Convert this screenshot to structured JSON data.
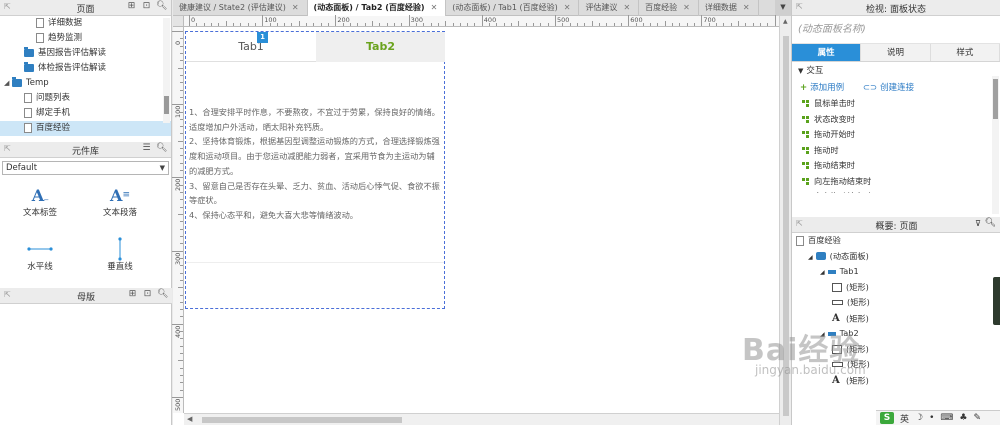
{
  "left_panel": {
    "pages_title": "页面",
    "tree": [
      {
        "label": "详细数据",
        "type": "page",
        "indent": 2
      },
      {
        "label": "趋势监测",
        "type": "page",
        "indent": 2
      },
      {
        "label": "基因报告评估解读",
        "type": "folder",
        "indent": 1
      },
      {
        "label": "体检报告评估解读",
        "type": "folder",
        "indent": 1
      },
      {
        "label": "Temp",
        "type": "folder-open",
        "indent": 0
      },
      {
        "label": "问题列表",
        "type": "page",
        "indent": 1
      },
      {
        "label": "绑定手机",
        "type": "page",
        "indent": 1
      },
      {
        "label": "百度经验",
        "type": "page",
        "indent": 1,
        "selected": true
      }
    ],
    "library_title": "元件库",
    "library_select": "Default",
    "widgets": [
      {
        "label": "文本标签",
        "icon": "text-label-icon"
      },
      {
        "label": "文本段落",
        "icon": "text-paragraph-icon"
      },
      {
        "label": "水平线",
        "icon": "horizontal-line-icon"
      },
      {
        "label": "垂直线",
        "icon": "vertical-line-icon"
      }
    ],
    "masters_title": "母版"
  },
  "tabs": [
    {
      "label": "健康建议 / State2 (评估建议)",
      "active": false
    },
    {
      "label": "(动态面板) / Tab2 (百度经验)",
      "active": true
    },
    {
      "label": "(动态面板) / Tab1 (百度经验)",
      "active": false
    },
    {
      "label": "评估建议",
      "active": false
    },
    {
      "label": "百度经验",
      "active": false
    },
    {
      "label": "详细数据",
      "active": false
    }
  ],
  "ruler": {
    "h_labels": [
      "0",
      "100",
      "200",
      "300",
      "400",
      "500",
      "600",
      "700",
      "800"
    ],
    "v_labels": [
      "0",
      "100",
      "200",
      "300",
      "400",
      "500"
    ]
  },
  "canvas": {
    "tab1": "Tab1",
    "tab2": "Tab2",
    "badge": "1",
    "lines": [
      "1、合理安排平时作息，不要熬夜，不宜过于劳累，保持良好的情绪。适度增加户外活动，晒太阳补充钙质。",
      "2、坚持体育锻炼，根据基因型调整运动锻炼的方式，合理选择锻炼强度和运动项目。由于您运动减肥能力弱者，宜采用节食为主运动为辅的减肥方式。",
      "3、留意自己是否存在头晕、乏力、贫血、活动后心悸气促、食欲不振等症状。",
      "4、保持心态平和，避免大喜大悲等情绪波动。"
    ]
  },
  "right_panel": {
    "inspector_title": "检视: 面板状态",
    "name_placeholder": "(动态面板名称)",
    "tabs": [
      "属性",
      "说明",
      "样式"
    ],
    "section": "交互",
    "add_case": "添加用例",
    "create_link": "创建连接",
    "events": [
      "鼠标单击时",
      "状态改变时",
      "拖动开始时",
      "拖动时",
      "拖动结束时",
      "向左拖动结束时",
      "向右拖动结束时"
    ],
    "outline_title": "概要: 页面",
    "outline": [
      {
        "label": "百度经验",
        "icon": "page",
        "indent": 0
      },
      {
        "label": "(动态面板)",
        "icon": "dynamic-panel",
        "indent": 1
      },
      {
        "label": "Tab1",
        "icon": "state",
        "indent": 2
      },
      {
        "label": "(矩形)",
        "icon": "rect",
        "indent": 3
      },
      {
        "label": "(矩形)",
        "icon": "line",
        "indent": 3
      },
      {
        "label": "(矩形)",
        "icon": "text",
        "indent": 3
      },
      {
        "label": "Tab2",
        "icon": "state",
        "indent": 2
      },
      {
        "label": "(矩形)",
        "icon": "rect",
        "indent": 3
      },
      {
        "label": "(矩形)",
        "icon": "line",
        "indent": 3
      },
      {
        "label": "(矩形)",
        "icon": "text",
        "indent": 3
      }
    ],
    "ime": "英"
  },
  "watermark": {
    "main": "Bai经验",
    "sub": "jingyan.baidu.com"
  },
  "colors": {
    "accent": "#2a8fd8",
    "tab2_text": "#6aa31d",
    "panel_border": "#4a6fd8"
  }
}
